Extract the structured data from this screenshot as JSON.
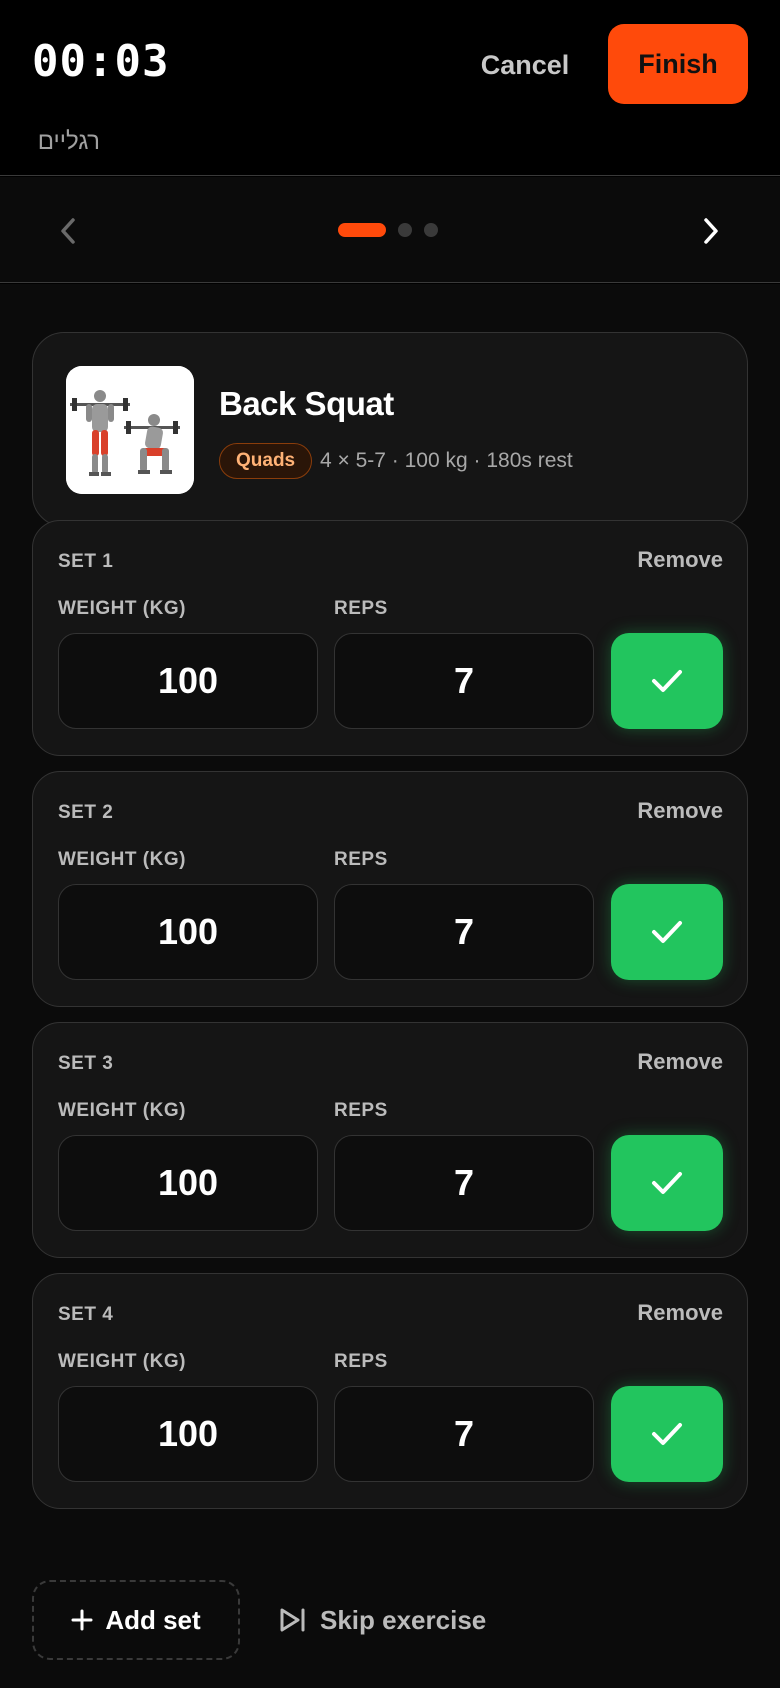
{
  "header": {
    "timer": "00:03",
    "cancel_label": "Cancel",
    "finish_label": "Finish",
    "workout_name": "רגליים"
  },
  "pager": {
    "total": 3,
    "current": 1
  },
  "exercise": {
    "name": "Back Squat",
    "muscle": "Quads",
    "summary": "4 × 5-7 · 100 kg · 180s rest"
  },
  "sets": [
    {
      "title": "SET 1",
      "remove_label": "Remove",
      "weight_label": "WEIGHT (KG)",
      "reps_label": "REPS",
      "weight": "100",
      "reps": "7",
      "completed": true
    },
    {
      "title": "SET 2",
      "remove_label": "Remove",
      "weight_label": "WEIGHT (KG)",
      "reps_label": "REPS",
      "weight": "100",
      "reps": "7",
      "completed": true
    },
    {
      "title": "SET 3",
      "remove_label": "Remove",
      "weight_label": "WEIGHT (KG)",
      "reps_label": "REPS",
      "weight": "100",
      "reps": "7",
      "completed": true
    },
    {
      "title": "SET 4",
      "remove_label": "Remove",
      "weight_label": "WEIGHT (KG)",
      "reps_label": "REPS",
      "weight": "100",
      "reps": "7",
      "completed": true
    }
  ],
  "actions": {
    "add_set_label": "Add set",
    "skip_label": "Skip exercise"
  },
  "colors": {
    "accent": "#ff4a0b",
    "success": "#22c55e",
    "background": "#0b0b0b"
  },
  "icons": {
    "prev": "chevron-left-icon",
    "next": "chevron-right-icon",
    "check": "check-icon",
    "add": "plus-icon",
    "skip": "skip-forward-icon"
  }
}
